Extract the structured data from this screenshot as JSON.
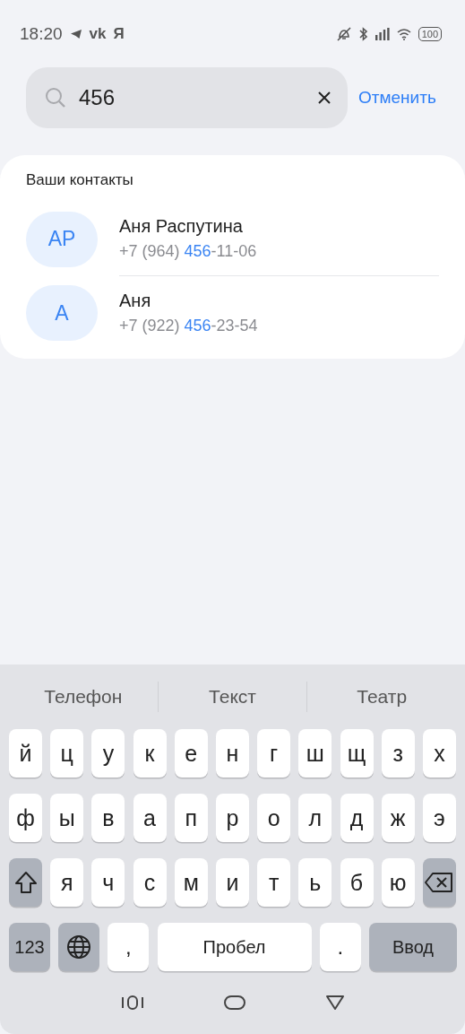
{
  "status_bar": {
    "time": "18:20",
    "app_marks": [
      "vk",
      "Я"
    ],
    "battery": "100"
  },
  "search": {
    "value": "456",
    "cancel": "Отменить"
  },
  "contacts": {
    "title": "Ваши контакты",
    "items": [
      {
        "initials": "АР",
        "name": "Аня Распутина",
        "phone": {
          "before": "+7 (964) ",
          "match": "456",
          "after": "-11-06"
        }
      },
      {
        "initials": "А",
        "name": "Аня",
        "phone": {
          "before": "+7 (922) ",
          "match": "456",
          "after": "-23-54"
        }
      }
    ]
  },
  "keyboard": {
    "suggestions": [
      "Телефон",
      "Текст",
      "Театр"
    ],
    "letter_rows": [
      [
        {
          "kind": "letter",
          "label": "й"
        },
        {
          "kind": "letter",
          "label": "ц"
        },
        {
          "kind": "letter",
          "label": "у"
        },
        {
          "kind": "letter",
          "label": "к"
        },
        {
          "kind": "letter",
          "label": "е"
        },
        {
          "kind": "letter",
          "label": "н"
        },
        {
          "kind": "letter",
          "label": "г"
        },
        {
          "kind": "letter",
          "label": "ш"
        },
        {
          "kind": "letter",
          "label": "щ"
        },
        {
          "kind": "letter",
          "label": "з"
        },
        {
          "kind": "letter",
          "label": "х"
        }
      ],
      [
        {
          "kind": "letter",
          "label": "ф"
        },
        {
          "kind": "letter",
          "label": "ы"
        },
        {
          "kind": "letter",
          "label": "в"
        },
        {
          "kind": "letter",
          "label": "а"
        },
        {
          "kind": "letter",
          "label": "п"
        },
        {
          "kind": "letter",
          "label": "р"
        },
        {
          "kind": "letter",
          "label": "о"
        },
        {
          "kind": "letter",
          "label": "л"
        },
        {
          "kind": "letter",
          "label": "д"
        },
        {
          "kind": "letter",
          "label": "ж"
        },
        {
          "kind": "letter",
          "label": "э"
        }
      ],
      [
        {
          "kind": "shift"
        },
        {
          "kind": "letter",
          "label": "я"
        },
        {
          "kind": "letter",
          "label": "ч"
        },
        {
          "kind": "letter",
          "label": "с"
        },
        {
          "kind": "letter",
          "label": "м"
        },
        {
          "kind": "letter",
          "label": "и"
        },
        {
          "kind": "letter",
          "label": "т"
        },
        {
          "kind": "letter",
          "label": "ь"
        },
        {
          "kind": "letter",
          "label": "б"
        },
        {
          "kind": "letter",
          "label": "ю"
        },
        {
          "kind": "backspace"
        }
      ]
    ],
    "bottom_row": [
      {
        "kind": "mode",
        "label": "123"
      },
      {
        "kind": "globe"
      },
      {
        "kind": "punct",
        "label": ","
      },
      {
        "kind": "space",
        "label": "Пробел"
      },
      {
        "kind": "punct",
        "label": "."
      },
      {
        "kind": "enter",
        "label": "Ввод"
      }
    ]
  }
}
